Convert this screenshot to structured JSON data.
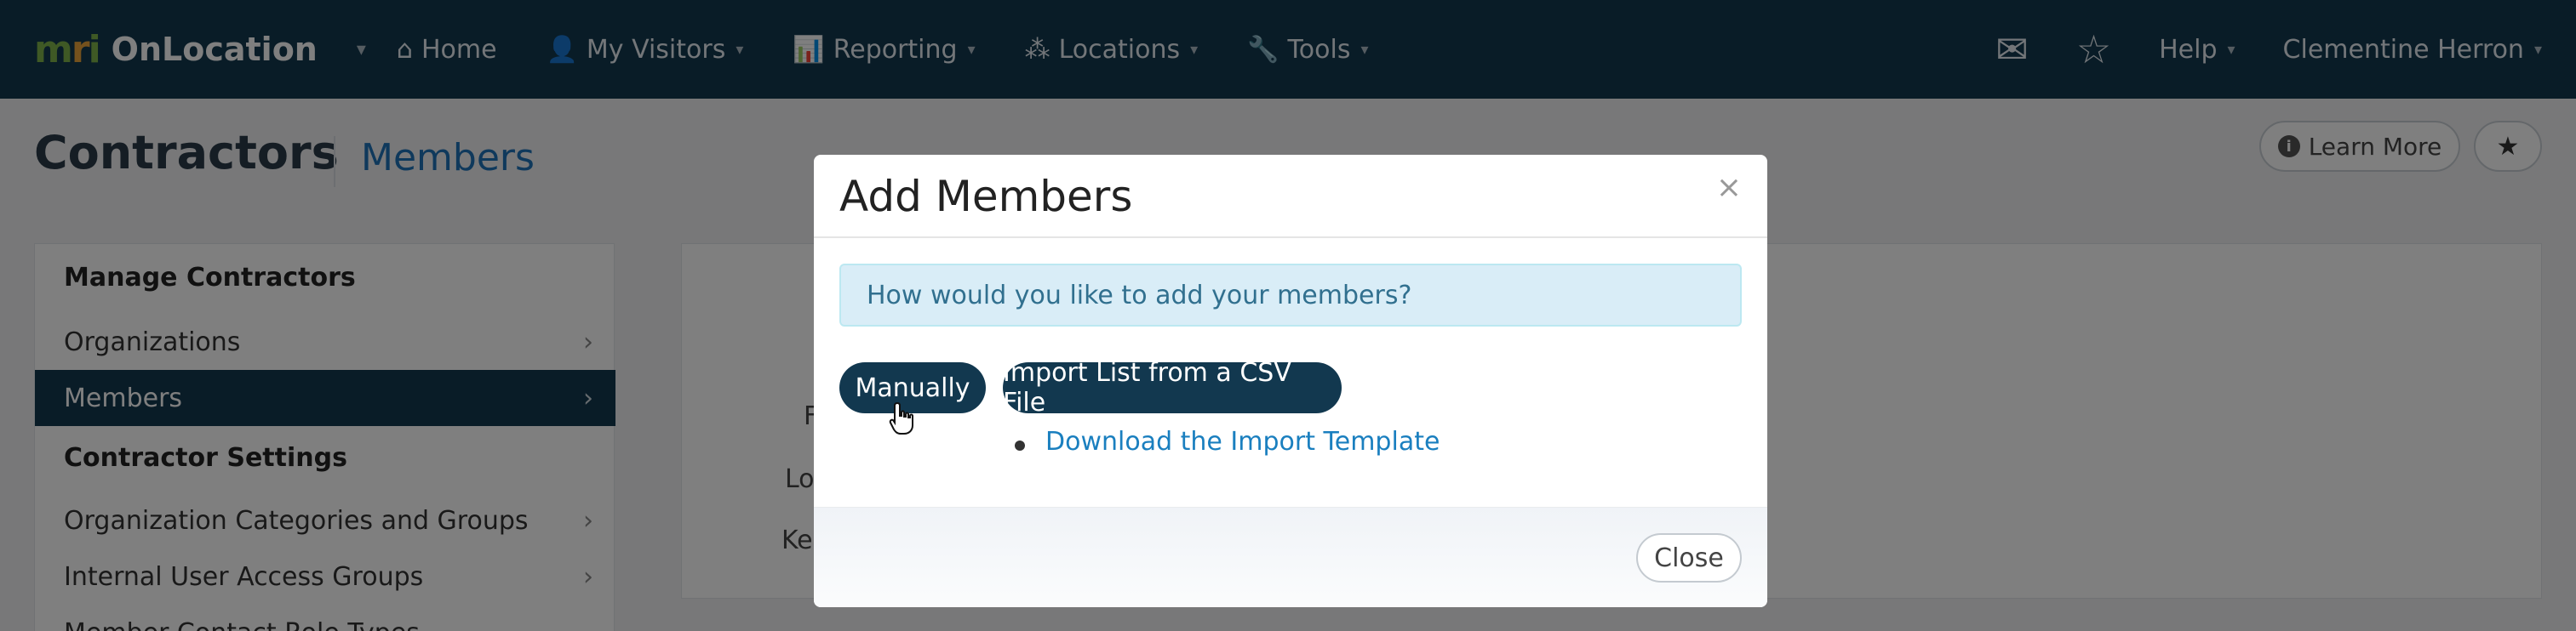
{
  "navbar": {
    "brand_logo": "mri",
    "brand_name": "OnLocation",
    "items": [
      {
        "label": "Home",
        "icon": "home-icon",
        "glyph": "⌂"
      },
      {
        "label": "My Visitors",
        "icon": "user-icon",
        "glyph": "👤"
      },
      {
        "label": "Reporting",
        "icon": "bar-chart-icon",
        "glyph": "📊"
      },
      {
        "label": "Locations",
        "icon": "network-icon",
        "glyph": "⁂"
      },
      {
        "label": "Tools",
        "icon": "wrench-icon",
        "glyph": "🔧"
      }
    ],
    "right": {
      "mail_glyph": "✉",
      "star_glyph": "☆",
      "help_label": "Help",
      "user_name": "Clementine Herron"
    },
    "caret": "▾"
  },
  "page": {
    "title": "Contractors",
    "subtitle": "Members",
    "learn_more_label": "Learn More",
    "info_glyph": "i",
    "fav_glyph": "★"
  },
  "sidebar": {
    "heading_manage": "Manage Contractors",
    "items_manage": [
      {
        "label": "Organizations"
      },
      {
        "label": "Members",
        "active": true
      }
    ],
    "heading_settings": "Contractor Settings",
    "items_settings": [
      {
        "label": "Organization Categories and Groups"
      },
      {
        "label": "Internal User Access Groups"
      },
      {
        "label": "Member Contact Role Types"
      }
    ],
    "chevron": "›"
  },
  "background_fragments": [
    "F",
    "Lo",
    "Ke"
  ],
  "modal": {
    "title": "Add Members",
    "close_x": "×",
    "prompt": "How would you like to add your members?",
    "manual_label": "Manually",
    "import_label": "Import List from a CSV File",
    "download_label": "Download the Import Template",
    "close_label": "Close"
  },
  "colors": {
    "navbar_bg": "#12384f",
    "accent_link": "#1a7fbf",
    "alert_bg": "#d9edf7",
    "alert_text": "#31708f"
  }
}
